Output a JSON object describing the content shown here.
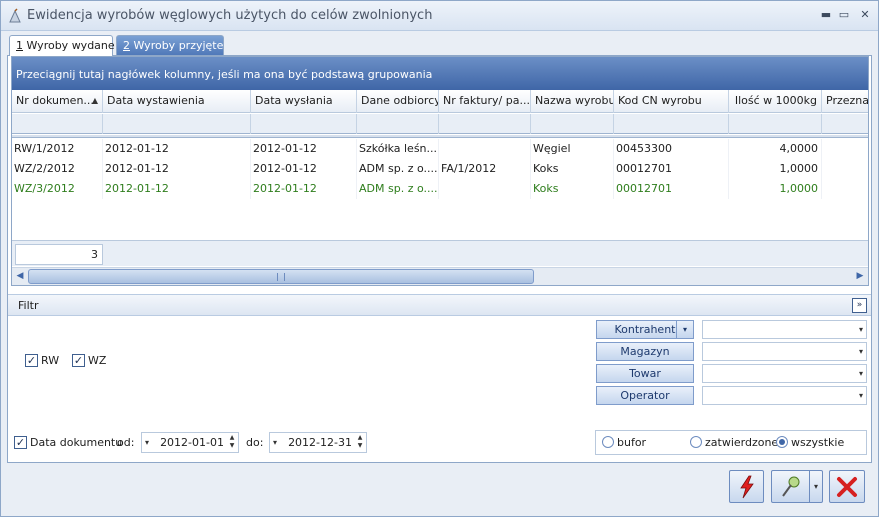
{
  "window": {
    "title": "Ewidencja wyrobów węglowych użytych do celów zwolnionych"
  },
  "tabs": [
    {
      "key": "1",
      "label": " Wyroby wydane"
    },
    {
      "key": "2",
      "label": " Wyroby przyjęte"
    }
  ],
  "grid": {
    "group_hint": "Przeciągnij tutaj nagłówek kolumny, jeśli ma ona być podstawą grupowania",
    "columns": [
      "Nr dokumen...",
      "Data wystawienia",
      "Data wysłania",
      "Dane odbiorcy",
      "Nr faktury/ pa...",
      "Nazwa wyrobu",
      "Kod CN wyrobu",
      "Ilość w 1000kg",
      "Przeznac"
    ],
    "rows": [
      [
        "RW/1/2012",
        "2012-01-12",
        "2012-01-12",
        "Szkółka leśn...",
        "",
        "Węgiel",
        "00453300",
        "4,0000"
      ],
      [
        "WZ/2/2012",
        "2012-01-12",
        "2012-01-12",
        "ADM sp. z o....",
        "FA/1/2012",
        "Koks",
        "00012701",
        "1,0000"
      ],
      [
        "WZ/3/2012",
        "2012-01-12",
        "2012-01-12",
        "ADM sp. z o....",
        "",
        "Koks",
        "00012701",
        "1,0000"
      ]
    ],
    "count": "3"
  },
  "filter": {
    "title": "Filtr",
    "rw_label": "RW",
    "wz_label": "WZ",
    "contractor_label": "Kontrahent",
    "warehouse_label": "Magazyn",
    "product_label": "Towar",
    "operator_label": "Operator",
    "date_doc_label": "Data dokumentu",
    "from_label": "od:",
    "to_label": "do:",
    "date_from": "2012-01-01",
    "date_to": "2012-12-31",
    "radio_draft": "bufor",
    "radio_approved": "zatwierdzone",
    "radio_all": "wszystkie"
  },
  "icons": {
    "lightning": "lightning-icon",
    "pin": "pin-icon",
    "close": "close-x-icon"
  }
}
